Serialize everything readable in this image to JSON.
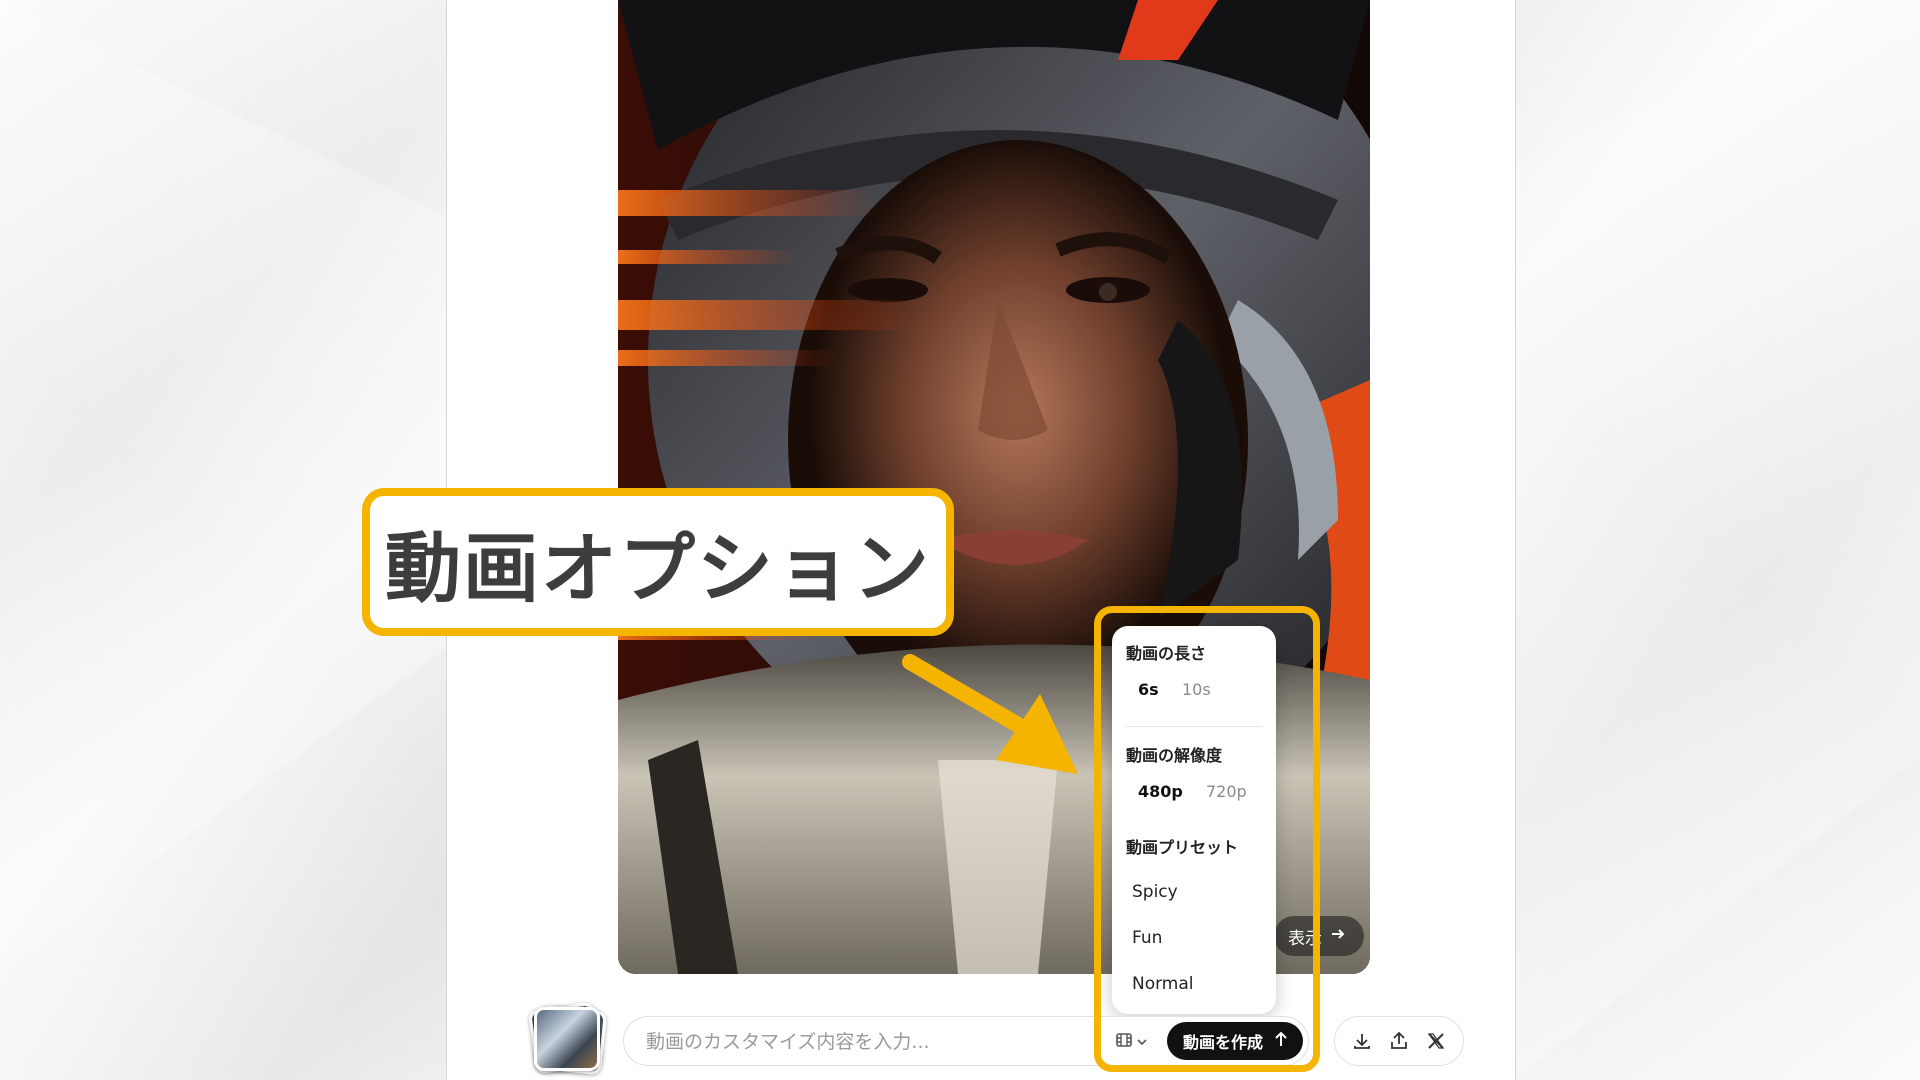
{
  "annotation": {
    "callout_text": "動画オプション",
    "accent_color": "#f4b400"
  },
  "image_overlay": {
    "view_more_label": "表示"
  },
  "options_menu": {
    "length_heading": "動画の長さ",
    "length_options": [
      "6s",
      "10s"
    ],
    "length_selected": "6s",
    "resolution_heading": "動画の解像度",
    "resolution_options": [
      "480p",
      "720p"
    ],
    "resolution_selected": "480p",
    "preset_heading": "動画プリセット",
    "presets": [
      "Spicy",
      "Fun",
      "Normal"
    ]
  },
  "composer": {
    "placeholder": "動画のカスタマイズ内容を入力...",
    "options_icon": "film-icon",
    "create_button_label": "動画を作成",
    "create_button_icon": "arrow-up-icon"
  },
  "actions": {
    "icons": [
      "download-icon",
      "share-icon",
      "x-logo-icon"
    ]
  }
}
